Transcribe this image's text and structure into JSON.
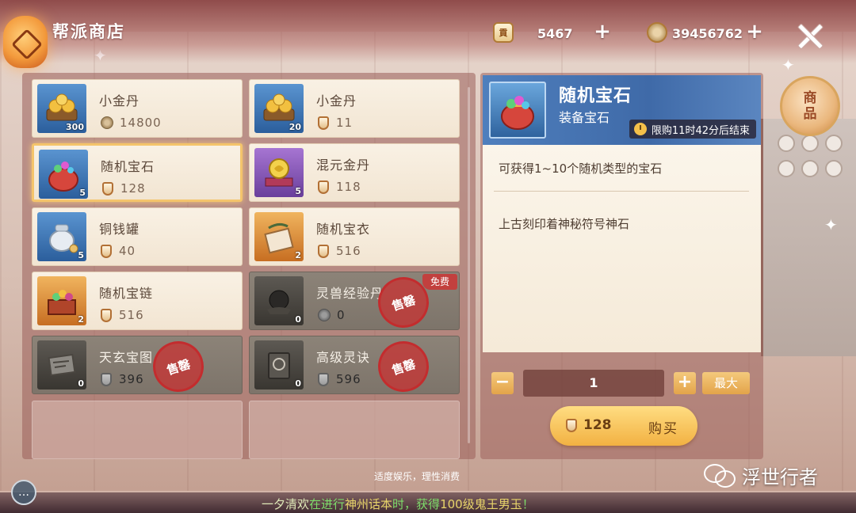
{
  "header": {
    "title": "帮派商店",
    "currency1": {
      "icon": "guild-token-icon",
      "glyph": "貢",
      "value": "5467"
    },
    "currency2": {
      "icon": "copper-coin-icon",
      "value": "39456762"
    },
    "plus": "+"
  },
  "items": [
    {
      "name": "小金丹",
      "count": "300",
      "price_icon": "copper-coin-icon",
      "price": "14800",
      "rarity": "blue",
      "art": "gold-pills",
      "state": "normal"
    },
    {
      "name": "小金丹",
      "count": "20",
      "price_icon": "guild-token-icon",
      "price": "11",
      "rarity": "blue",
      "art": "gold-pills",
      "state": "normal"
    },
    {
      "name": "随机宝石",
      "count": "5",
      "price_icon": "guild-token-icon",
      "price": "128",
      "rarity": "blue",
      "art": "gem-pouch",
      "state": "selected"
    },
    {
      "name": "混元金丹",
      "count": "5",
      "price_icon": "guild-token-icon",
      "price": "118",
      "rarity": "purple",
      "art": "golden-orb",
      "state": "normal"
    },
    {
      "name": "铜钱罐",
      "count": "5",
      "price_icon": "guild-token-icon",
      "price": "40",
      "rarity": "blue",
      "art": "coin-jar",
      "state": "normal"
    },
    {
      "name": "随机宝衣",
      "count": "2",
      "price_icon": "guild-token-icon",
      "price": "516",
      "rarity": "orange",
      "art": "robe-box",
      "state": "normal"
    },
    {
      "name": "随机宝链",
      "count": "2",
      "price_icon": "guild-token-icon",
      "price": "516",
      "rarity": "orange",
      "art": "treasure-chest",
      "state": "normal"
    },
    {
      "name": "灵兽经验丹",
      "count": "0",
      "price_icon": "copper-coin-icon",
      "price": "0",
      "rarity": "gray",
      "art": "dark-orb",
      "state": "soldout",
      "free_tag": "免费",
      "stamp": "售罄"
    },
    {
      "name": "天玄宝图",
      "count": "0",
      "price_icon": "guild-token-icon",
      "price": "396",
      "rarity": "gray",
      "art": "map-scroll",
      "state": "soldout",
      "stamp": "售罄"
    },
    {
      "name": "高级灵诀",
      "count": "0",
      "price_icon": "guild-token-icon",
      "price": "596",
      "rarity": "gray",
      "art": "skill-book",
      "state": "soldout",
      "stamp": "售罄"
    }
  ],
  "detail": {
    "name": "随机宝石",
    "type": "装备宝石",
    "timer": "限购11时42分后结束",
    "desc1": "可获得1~10个随机类型的宝石",
    "desc2": "上古刻印着神秘符号神石",
    "quantity": "1",
    "minus": "−",
    "plus": "+",
    "max_label": "最大",
    "price": "128",
    "buy_label": "购买"
  },
  "side_tab": {
    "line1": "商",
    "line2": "品"
  },
  "footer": {
    "note": "适度娱乐，理性消费",
    "marquee_1": "一夕清欢",
    "marquee_2": "在进行",
    "marquee_3": "神州话本",
    "marquee_4": "时，获得",
    "marquee_5": "100级鬼王男玉",
    "marquee_6": "！"
  },
  "watermark": "浮世行者",
  "colors": {
    "selected_border": "#f4c46b",
    "soldout_stamp": "#c42a2c",
    "buy_button": "#f2b142",
    "detail_header": "#4f7fbd"
  }
}
